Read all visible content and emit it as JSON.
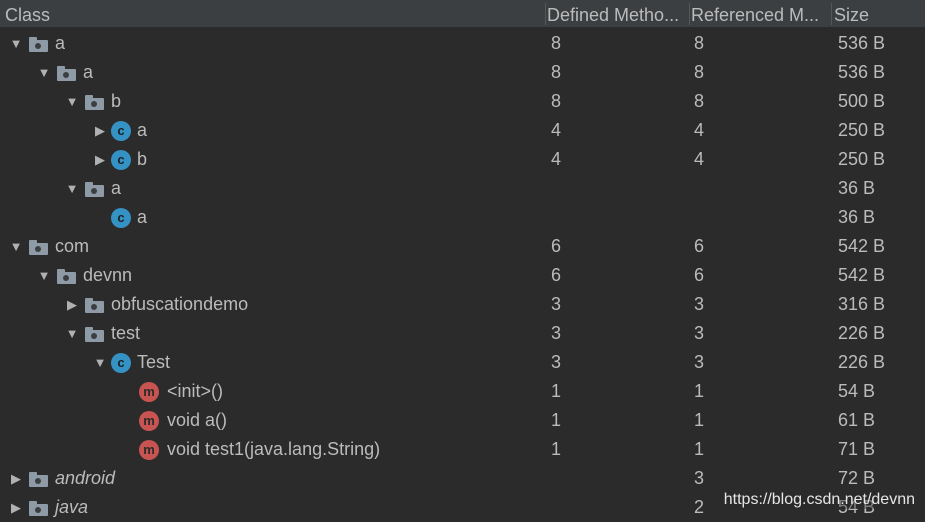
{
  "header": {
    "class_label": "Class",
    "defined_label": "Defined Metho...",
    "referenced_label": "Referenced M...",
    "size_label": "Size"
  },
  "rows": [
    {
      "indent": 0,
      "arrow": "expanded",
      "icon": "folder",
      "name": "a",
      "defined": "8",
      "referenced": "8",
      "size": "536 B"
    },
    {
      "indent": 1,
      "arrow": "expanded",
      "icon": "folder",
      "name": "a",
      "defined": "8",
      "referenced": "8",
      "size": "536 B"
    },
    {
      "indent": 2,
      "arrow": "expanded",
      "icon": "folder",
      "name": "b",
      "defined": "8",
      "referenced": "8",
      "size": "500 B"
    },
    {
      "indent": 3,
      "arrow": "collapsed",
      "icon": "class",
      "name": "a",
      "defined": "4",
      "referenced": "4",
      "size": "250 B"
    },
    {
      "indent": 3,
      "arrow": "collapsed",
      "icon": "class",
      "name": "b",
      "defined": "4",
      "referenced": "4",
      "size": "250 B"
    },
    {
      "indent": 2,
      "arrow": "expanded",
      "icon": "folder",
      "name": "a",
      "defined": "",
      "referenced": "",
      "size": "36 B"
    },
    {
      "indent": 3,
      "arrow": "none",
      "icon": "class",
      "name": "a",
      "defined": "",
      "referenced": "",
      "size": "36 B"
    },
    {
      "indent": 0,
      "arrow": "expanded",
      "icon": "folder",
      "name": "com",
      "defined": "6",
      "referenced": "6",
      "size": "542 B"
    },
    {
      "indent": 1,
      "arrow": "expanded",
      "icon": "folder",
      "name": "devnn",
      "defined": "6",
      "referenced": "6",
      "size": "542 B"
    },
    {
      "indent": 2,
      "arrow": "collapsed",
      "icon": "folder",
      "name": "obfuscationdemo",
      "defined": "3",
      "referenced": "3",
      "size": "316 B"
    },
    {
      "indent": 2,
      "arrow": "expanded",
      "icon": "folder",
      "name": "test",
      "defined": "3",
      "referenced": "3",
      "size": "226 B"
    },
    {
      "indent": 3,
      "arrow": "expanded",
      "icon": "class",
      "name": "Test",
      "defined": "3",
      "referenced": "3",
      "size": "226 B"
    },
    {
      "indent": 4,
      "arrow": "none",
      "icon": "method",
      "name": "<init>()",
      "defined": "1",
      "referenced": "1",
      "size": "54 B"
    },
    {
      "indent": 4,
      "arrow": "none",
      "icon": "method",
      "name": "void a()",
      "defined": "1",
      "referenced": "1",
      "size": "61 B"
    },
    {
      "indent": 4,
      "arrow": "none",
      "icon": "method",
      "name": "void test1(java.lang.String)",
      "defined": "1",
      "referenced": "1",
      "size": "71 B"
    },
    {
      "indent": 0,
      "arrow": "collapsed",
      "icon": "folder",
      "name": "android",
      "italic": true,
      "defined": "",
      "referenced": "3",
      "size": "72 B"
    },
    {
      "indent": 0,
      "arrow": "collapsed",
      "icon": "folder",
      "name": "java",
      "italic": true,
      "defined": "",
      "referenced": "2",
      "size": "54 B"
    }
  ],
  "icons": {
    "class_letter": "c",
    "method_letter": "m"
  },
  "watermark": "https://blog.csdn.net/devnn"
}
